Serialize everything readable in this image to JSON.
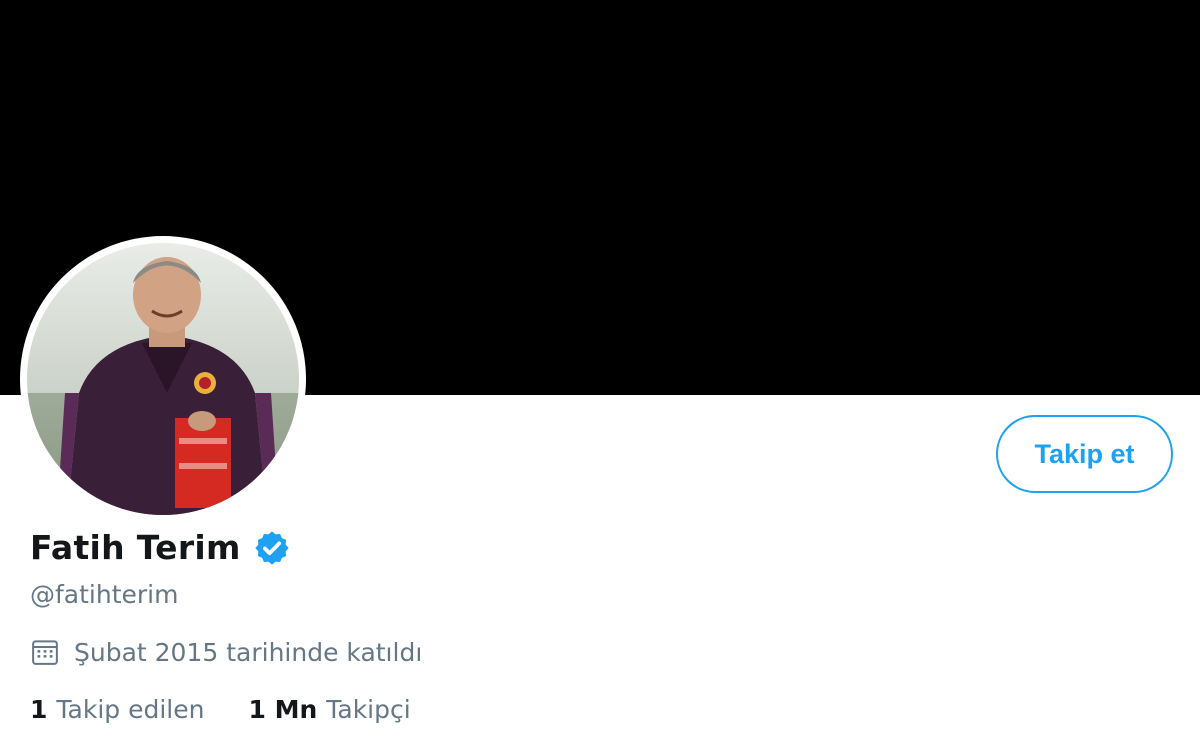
{
  "profile": {
    "display_name": "Fatih Terim",
    "handle": "@fatihterim",
    "joined": "Şubat 2015 tarihinde katıldı",
    "verified": true
  },
  "actions": {
    "follow_label": "Takip et"
  },
  "stats": {
    "following_count": "1",
    "following_label": "Takip edilen",
    "followers_count": "1 Mn",
    "followers_label": "Takipçi"
  },
  "icons": {
    "verified": "verified-badge-icon",
    "calendar": "calendar-icon"
  },
  "colors": {
    "accent": "#1da1f2",
    "banner": "#000000",
    "name_text": "#14171a",
    "secondary_text": "#657786"
  }
}
